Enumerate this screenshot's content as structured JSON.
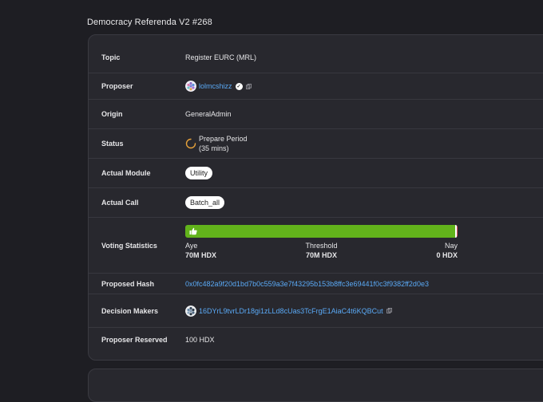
{
  "title": "Democracy Referenda V2 #268",
  "rows": {
    "topic": {
      "label": "Topic",
      "value": "Register EURC (MRL)"
    },
    "proposer": {
      "label": "Proposer",
      "value": "lolmcshizz"
    },
    "origin": {
      "label": "Origin",
      "value": "GeneralAdmin"
    },
    "status": {
      "label": "Status",
      "line1": "Prepare Period",
      "line2": "(35 mins)"
    },
    "module": {
      "label": "Actual Module",
      "value": "Utility"
    },
    "call": {
      "label": "Actual Call",
      "value": "Batch_all"
    },
    "voting": {
      "label": "Voting Statistics",
      "aye_label": "Aye",
      "threshold_label": "Threshold",
      "nay_label": "Nay",
      "aye_value": "70M HDX",
      "threshold_value": "70M HDX",
      "nay_value": "0 HDX",
      "aye_fraction": 0.99,
      "nay_fraction": 0.01,
      "aye_color": "#62b31b",
      "nay_color": "#e35a63"
    },
    "hash": {
      "label": "Proposed Hash",
      "value": "0x0fc482a9f20d1bd7b0c559a3e7f43295b153b8ffc3e69441f0c3f9382ff2d0e3"
    },
    "decision": {
      "label": "Decision Makers",
      "value": "16DYrL9tvrLDr18gi1zLLd8cUas3TcFrgE1AiaC4t6KQBCut"
    },
    "reserved": {
      "label": "Proposer Reserved",
      "value": "100 HDX"
    }
  },
  "icons": {
    "status": "loading-spinner-icon",
    "copy": "copy-icon",
    "verified": "verified-badge-icon",
    "aye": "thumbs-up-icon",
    "nay": "thumbs-down-icon"
  }
}
